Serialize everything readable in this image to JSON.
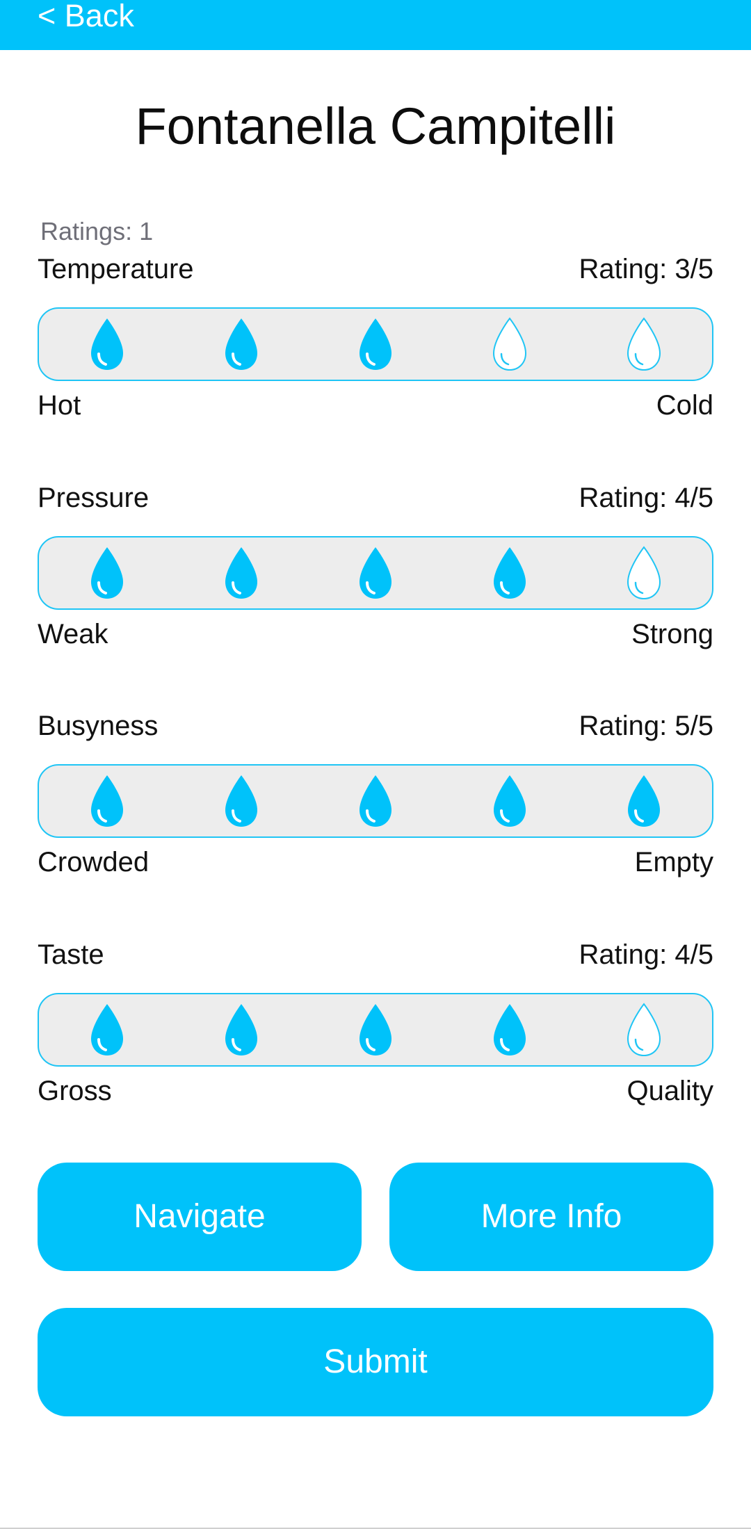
{
  "header": {
    "back_label": "< Back",
    "color": "#00C2FA"
  },
  "title": "Fontanella Campitelli",
  "ratings_count": "Ratings: 1",
  "max_rating": 5,
  "categories": [
    {
      "name": "Temperature",
      "rating_label": "Rating: 3/5",
      "rating": 3,
      "low_label": "Hot",
      "high_label": "Cold"
    },
    {
      "name": "Pressure",
      "rating_label": "Rating: 4/5",
      "rating": 4,
      "low_label": "Weak",
      "high_label": "Strong"
    },
    {
      "name": "Busyness",
      "rating_label": "Rating: 5/5",
      "rating": 5,
      "low_label": "Crowded",
      "high_label": "Empty"
    },
    {
      "name": "Taste",
      "rating_label": "Rating: 4/5",
      "rating": 4,
      "low_label": "Gross",
      "high_label": "Quality"
    }
  ],
  "buttons": {
    "navigate": "Navigate",
    "more_info": "More Info",
    "submit": "Submit"
  },
  "icons": {
    "rating_icon": "water-drop-icon"
  },
  "colors": {
    "accent": "#00C2FA",
    "drop_outline": "#1FC5F5",
    "bar_bg": "#EDEDED"
  }
}
